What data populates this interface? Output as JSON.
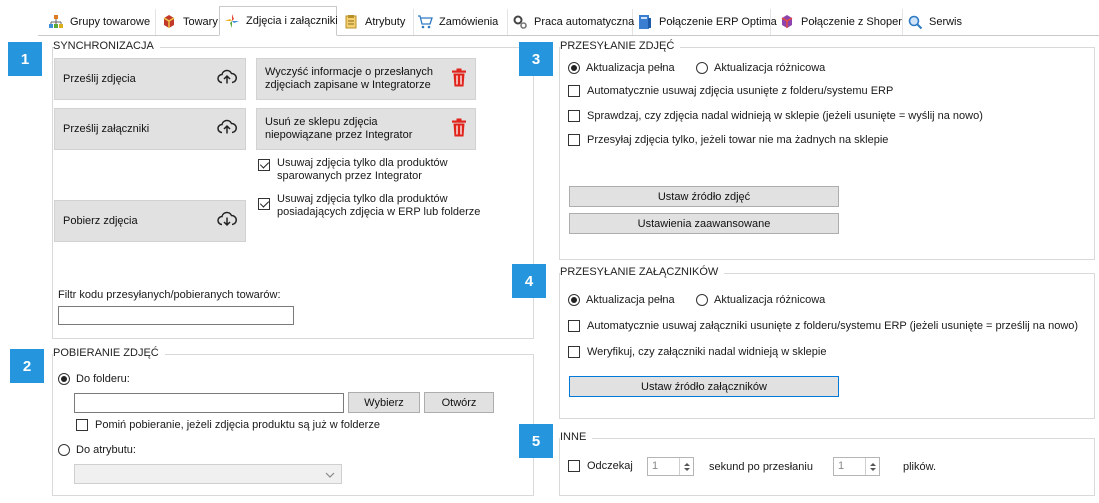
{
  "tabs": [
    {
      "label": "Grupy towarowe",
      "icon": "product-groups-icon"
    },
    {
      "label": "Towary",
      "icon": "products-icon"
    },
    {
      "label": "Zdjęcia i załączniki",
      "icon": "images-icon",
      "active": true
    },
    {
      "label": "Atrybuty",
      "icon": "attributes-icon"
    },
    {
      "label": "Zamówienia",
      "icon": "cart-icon"
    },
    {
      "label": "Praca automatyczna",
      "icon": "automation-icon"
    },
    {
      "label": "Połączenie ERP Optima",
      "icon": "erp-icon"
    },
    {
      "label": "Połączenie z Shoper",
      "icon": "shoper-icon"
    },
    {
      "label": "Serwis",
      "icon": "service-icon"
    }
  ],
  "badges": [
    "1",
    "2",
    "3",
    "4",
    "5"
  ],
  "sync": {
    "title": "SYNCHRONIZACJA",
    "send_images": "Prześlij zdjęcia",
    "send_attachments": "Prześlij załączniki",
    "download_images": "Pobierz zdjęcia",
    "clear_info": "Wyczyść informacje o przesłanych zdjęciach zapisane w Integratorze",
    "remove_unlinked": "Usuń ze sklepu zdjęcia niepowiązane przez Integrator",
    "only_paired": "Usuwaj zdjęcia tylko dla produktów sparowanych przez Integrator",
    "only_with_images": "Usuwaj zdjęcia tylko dla produktów posiadających zdjęcia w ERP lub folderze",
    "filter_label": "Filtr kodu przesyłanych/pobieranych towarów:",
    "filter_value": ""
  },
  "download": {
    "title": "POBIERANIE ZDJĘĆ",
    "to_folder": "Do folderu:",
    "folder_value": "",
    "choose": "Wybierz",
    "open": "Otwórz",
    "skip_existing": "Pomiń pobieranie, jeżeli zdjęcia produktu są już w folderze",
    "to_attribute": "Do atrybutu:",
    "attribute_value": ""
  },
  "upload_images": {
    "title": "PRZESYŁANIE ZDJĘĆ",
    "full_update": "Aktualizacja pełna",
    "diff_update": "Aktualizacja różnicowa",
    "auto_remove": "Automatycznie usuwaj zdjęcia usunięte z folderu/systemu ERP",
    "check_exists": "Sprawdzaj, czy zdjęcia nadal widnieją w sklepie (jeżeli usunięte = wyślij na nowo)",
    "only_if_none": "Przesyłaj zdjęcia tylko, jeżeli towar nie ma żadnych na sklepie",
    "set_source": "Ustaw źródło zdjęć",
    "advanced": "Ustawienia zaawansowane"
  },
  "upload_attachments": {
    "title": "PRZESYŁANIE ZAŁĄCZNIKÓW",
    "full_update": "Aktualizacja pełna",
    "diff_update": "Aktualizacja różnicowa",
    "auto_remove": "Automatycznie usuwaj załączniki usunięte z folderu/systemu ERP (jeżeli usunięte = prześlij na nowo)",
    "verify": "Weryfikuj, czy załączniki nadal widnieją w sklepie",
    "set_source": "Ustaw źródło załączników"
  },
  "other": {
    "title": "INNE",
    "wait": "Odczekaj",
    "seconds_value": "1",
    "after_label": "sekund po przesłaniu",
    "files_value": "1",
    "files_label": "plików."
  },
  "colors": {
    "badge": "#2596de",
    "trash": "#e0241b",
    "focus_border": "#0078d7"
  }
}
